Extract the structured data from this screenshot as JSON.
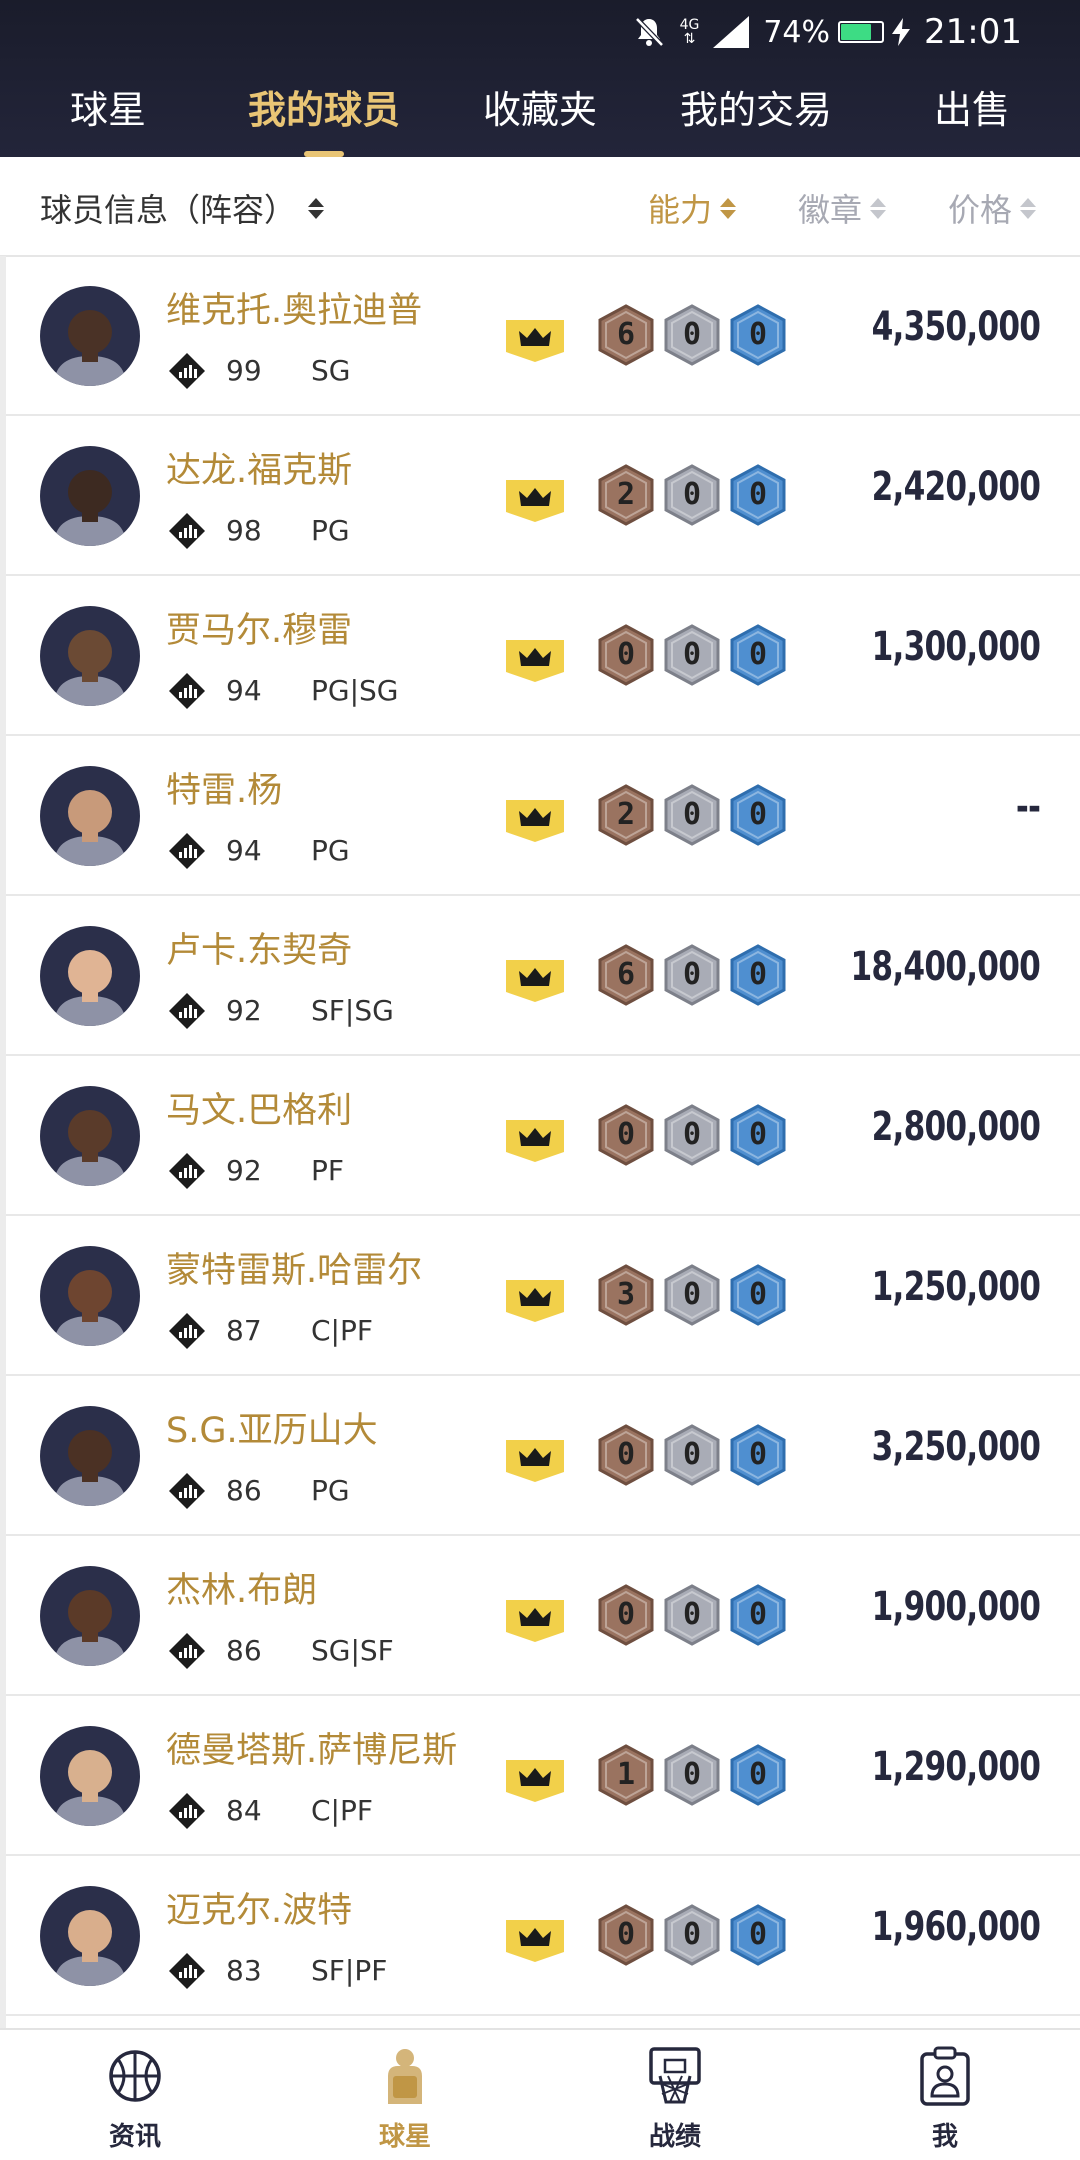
{
  "status_bar": {
    "network": "4G",
    "battery": "74%",
    "battery_level": 0.74,
    "time": "21:01"
  },
  "tabs": [
    {
      "label": "球星",
      "active": false
    },
    {
      "label": "我的球员",
      "active": true
    },
    {
      "label": "收藏夹",
      "active": false
    },
    {
      "label": "我的交易",
      "active": false
    },
    {
      "label": "出售",
      "active": false
    }
  ],
  "sort_header": {
    "player_info": "球员信息（阵容）",
    "ability": "能力",
    "badges": "徽章",
    "price": "价格"
  },
  "players": [
    {
      "name": "维克托.奥拉迪普",
      "rating": "99",
      "position": "SG",
      "badges": [
        "6",
        "0",
        "0"
      ],
      "price": "4,350,000"
    },
    {
      "name": "达龙.福克斯",
      "rating": "98",
      "position": "PG",
      "badges": [
        "2",
        "0",
        "0"
      ],
      "price": "2,420,000"
    },
    {
      "name": "贾马尔.穆雷",
      "rating": "94",
      "position": "PG|SG",
      "badges": [
        "0",
        "0",
        "0"
      ],
      "price": "1,300,000"
    },
    {
      "name": "特雷.杨",
      "rating": "94",
      "position": "PG",
      "badges": [
        "2",
        "0",
        "0"
      ],
      "price": "--"
    },
    {
      "name": "卢卡.东契奇",
      "rating": "92",
      "position": "SF|SG",
      "badges": [
        "6",
        "0",
        "0"
      ],
      "price": "18,400,000"
    },
    {
      "name": "马文.巴格利",
      "rating": "92",
      "position": "PF",
      "badges": [
        "0",
        "0",
        "0"
      ],
      "price": "2,800,000"
    },
    {
      "name": "蒙特雷斯.哈雷尔",
      "rating": "87",
      "position": "C|PF",
      "badges": [
        "3",
        "0",
        "0"
      ],
      "price": "1,250,000"
    },
    {
      "name": "S.G.亚历山大",
      "rating": "86",
      "position": "PG",
      "badges": [
        "0",
        "0",
        "0"
      ],
      "price": "3,250,000"
    },
    {
      "name": "杰林.布朗",
      "rating": "86",
      "position": "SG|SF",
      "badges": [
        "0",
        "0",
        "0"
      ],
      "price": "1,900,000"
    },
    {
      "name": "德曼塔斯.萨博尼斯",
      "rating": "84",
      "position": "C|PF",
      "badges": [
        "1",
        "0",
        "0"
      ],
      "price": "1,290,000"
    },
    {
      "name": "迈克尔.波特",
      "rating": "83",
      "position": "SF|PF",
      "badges": [
        "0",
        "0",
        "0"
      ],
      "price": "1,960,000"
    }
  ],
  "bottom_nav": [
    {
      "label": "资讯",
      "icon": "basketball-icon",
      "active": false
    },
    {
      "label": "球星",
      "icon": "player-jersey-icon",
      "active": true
    },
    {
      "label": "战绩",
      "icon": "hoop-icon",
      "active": false
    },
    {
      "label": "我",
      "icon": "profile-clipboard-icon",
      "active": false
    }
  ],
  "colors": {
    "header_bg": "#1f2133",
    "gold_accent": "#c09645",
    "active_tab": "#e9c575",
    "price_text": "#26283d",
    "bronze_badge": "#9a7360",
    "silver_badge": "#a9acb6",
    "gold_badge": "#4f8fd0",
    "crown_badge": "#f2d04a"
  }
}
